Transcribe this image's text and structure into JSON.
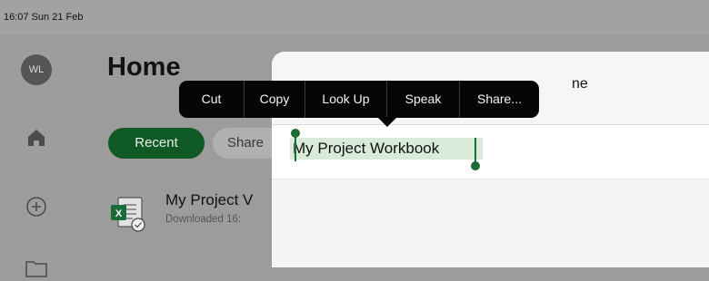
{
  "status": {
    "time_date": "16:07  Sun 21 Feb"
  },
  "sidebar": {
    "avatar_initials": "WL",
    "icons": [
      "home-icon",
      "add-icon",
      "folder-icon"
    ]
  },
  "home": {
    "title": "Home",
    "tabs": [
      {
        "label": "Recent",
        "selected": true
      },
      {
        "label": "Share"
      }
    ],
    "recent_file": {
      "name": "My Project V",
      "meta": "Downloaded 16:"
    }
  },
  "sheet": {
    "title_fragment": "ne",
    "name_value": "My Project Workbook"
  },
  "context_menu": {
    "items": [
      "Cut",
      "Copy",
      "Look Up",
      "Speak",
      "Share..."
    ]
  },
  "colors": {
    "accent": "#0f5a24",
    "selection": "#d9ead9",
    "menu_bg": "#050505"
  }
}
